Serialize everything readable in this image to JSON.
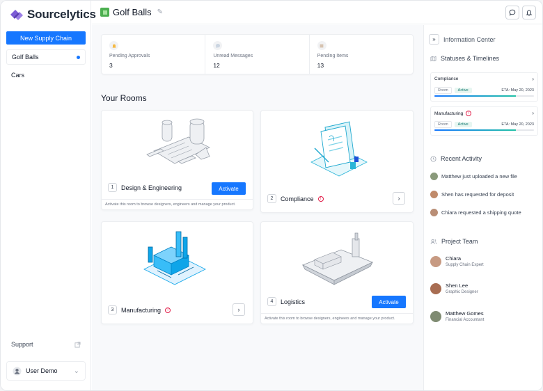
{
  "brand": {
    "name": "Sourcelytics",
    "accent": "#1677ff"
  },
  "sidebar": {
    "new_button": "New Supply Chain",
    "chains": [
      {
        "label": "Golf Balls",
        "active": true
      },
      {
        "label": "Cars",
        "active": false
      }
    ],
    "support": "Support",
    "user": "User Demo"
  },
  "topbar": {
    "title": "Golf Balls"
  },
  "stats": [
    {
      "label": "Pending Approvals",
      "value": "3",
      "icon": "bell-icon"
    },
    {
      "label": "Unread Messages",
      "value": "12",
      "icon": "chat-icon"
    },
    {
      "label": "Pending Items",
      "value": "13",
      "icon": "box-icon"
    }
  ],
  "rooms": {
    "title": "Your Rooms",
    "activate_label": "Activate",
    "note": "Activate this room to browse designers, engineers and manage your product.",
    "items": [
      {
        "num": "1",
        "name": "Design & Engineering"
      },
      {
        "num": "2",
        "name": "Compliance"
      },
      {
        "num": "3",
        "name": "Manufacturing"
      },
      {
        "num": "4",
        "name": "Logistics"
      }
    ]
  },
  "info": {
    "title": "Information Center",
    "statuses_title": "Statuses & Timelines",
    "timelines": [
      {
        "name": "Compliance",
        "room": "Room",
        "status": "Active",
        "eta": "ETA: May 20, 2023",
        "progress": 0.82
      },
      {
        "name": "Manufacturing",
        "room": "Room",
        "status": "Active",
        "eta": "ETA: May 20, 2023",
        "progress": 0.82
      }
    ],
    "activity_title": "Recent Activity",
    "activity": [
      {
        "text": "Matthew just uploaded a new file"
      },
      {
        "text": "Shen has requested for deposit"
      },
      {
        "text": "Chiara requested a shipping quote"
      }
    ],
    "team_title": "Project Team",
    "team": [
      {
        "name": "Chiara",
        "role": "Supply Chain Expert"
      },
      {
        "name": "Shen Lee",
        "role": "Graphic Designer"
      },
      {
        "name": "Matthew Gomes",
        "role": "Financial Accountant"
      }
    ]
  }
}
